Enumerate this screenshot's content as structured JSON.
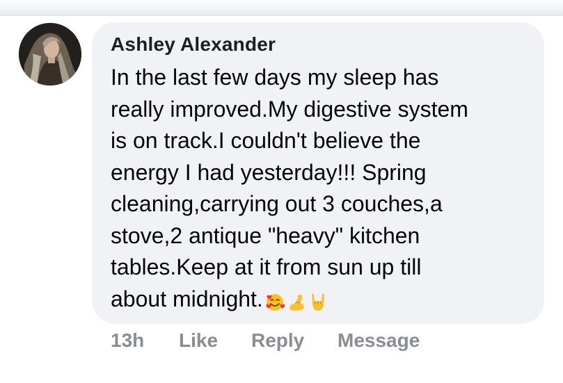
{
  "comment": {
    "author": "Ashley Alexander",
    "text_lines": [
      "In the last few days my sleep has",
      "really improved.My digestive system",
      "is on track.I couldn't believe the",
      "energy I had yesterday!!! Spring",
      "cleaning,carrying out 3 couches,a",
      "stove,2 antique \"heavy\" kitchen",
      "tables.Keep at it from sun up till",
      "about midnight."
    ],
    "emojis": [
      "smiling-face-with-hearts-icon",
      "flexed-biceps-icon",
      "sign-of-the-horns-icon"
    ]
  },
  "actions": {
    "timestamp": "13h",
    "like_label": "Like",
    "reply_label": "Reply",
    "message_label": "Message"
  },
  "colors": {
    "bubble": "#f0f2f5",
    "author": "#1c1e21",
    "text": "#050505",
    "action": "#8a8d91",
    "background": "#ffffff"
  }
}
